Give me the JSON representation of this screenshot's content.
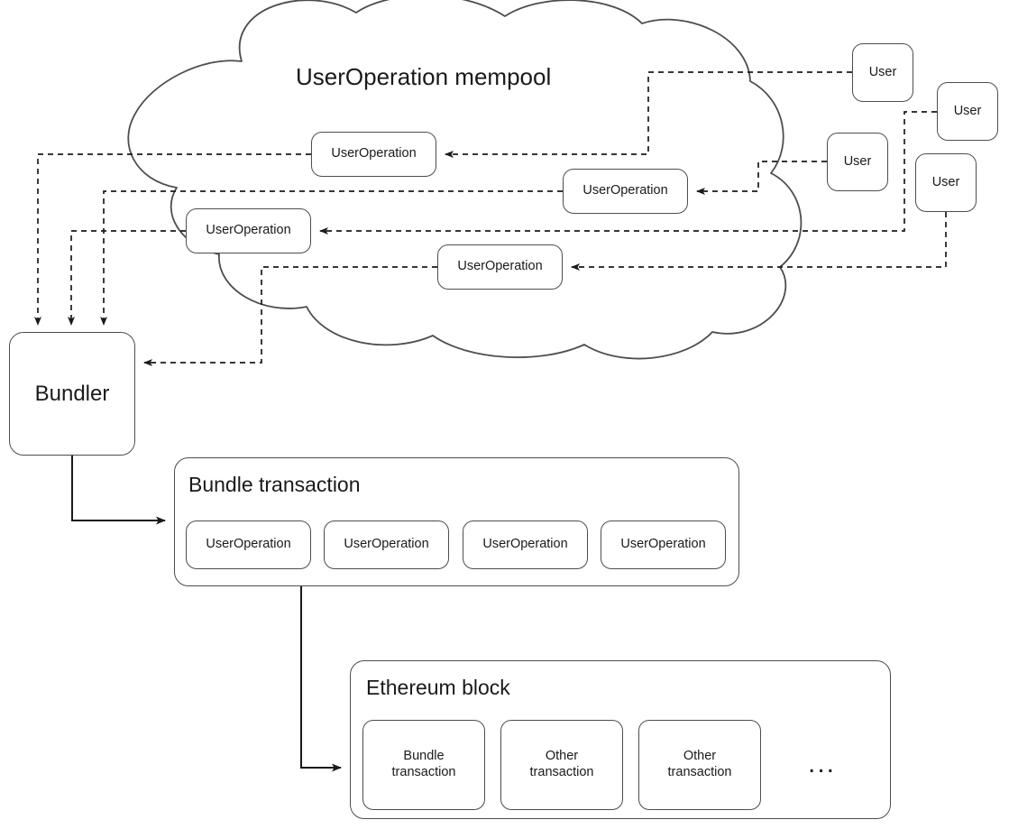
{
  "diagram": {
    "title": "UserOperation mempool",
    "background_color": "#ffffff",
    "stroke_color": "#4d4d4d",
    "text_color": "#1a1a1a"
  },
  "cloud": {
    "label": "UserOperation mempool",
    "userops": [
      {
        "label": "UserOperation"
      },
      {
        "label": "UserOperation"
      },
      {
        "label": "UserOperation"
      },
      {
        "label": "UserOperation"
      }
    ]
  },
  "users": [
    {
      "label": "User"
    },
    {
      "label": "User"
    },
    {
      "label": "User"
    },
    {
      "label": "User"
    }
  ],
  "bundler": {
    "label": "Bundler"
  },
  "bundle_transaction": {
    "title": "Bundle transaction",
    "userops": [
      {
        "label": "UserOperation"
      },
      {
        "label": "UserOperation"
      },
      {
        "label": "UserOperation"
      },
      {
        "label": "UserOperation"
      }
    ]
  },
  "ethereum_block": {
    "title": "Ethereum block",
    "transactions": [
      {
        "line1": "Bundle",
        "line2": "transaction"
      },
      {
        "line1": "Other",
        "line2": "transaction"
      },
      {
        "line1": "Other",
        "line2": "transaction"
      }
    ],
    "more_indicator": "..."
  }
}
